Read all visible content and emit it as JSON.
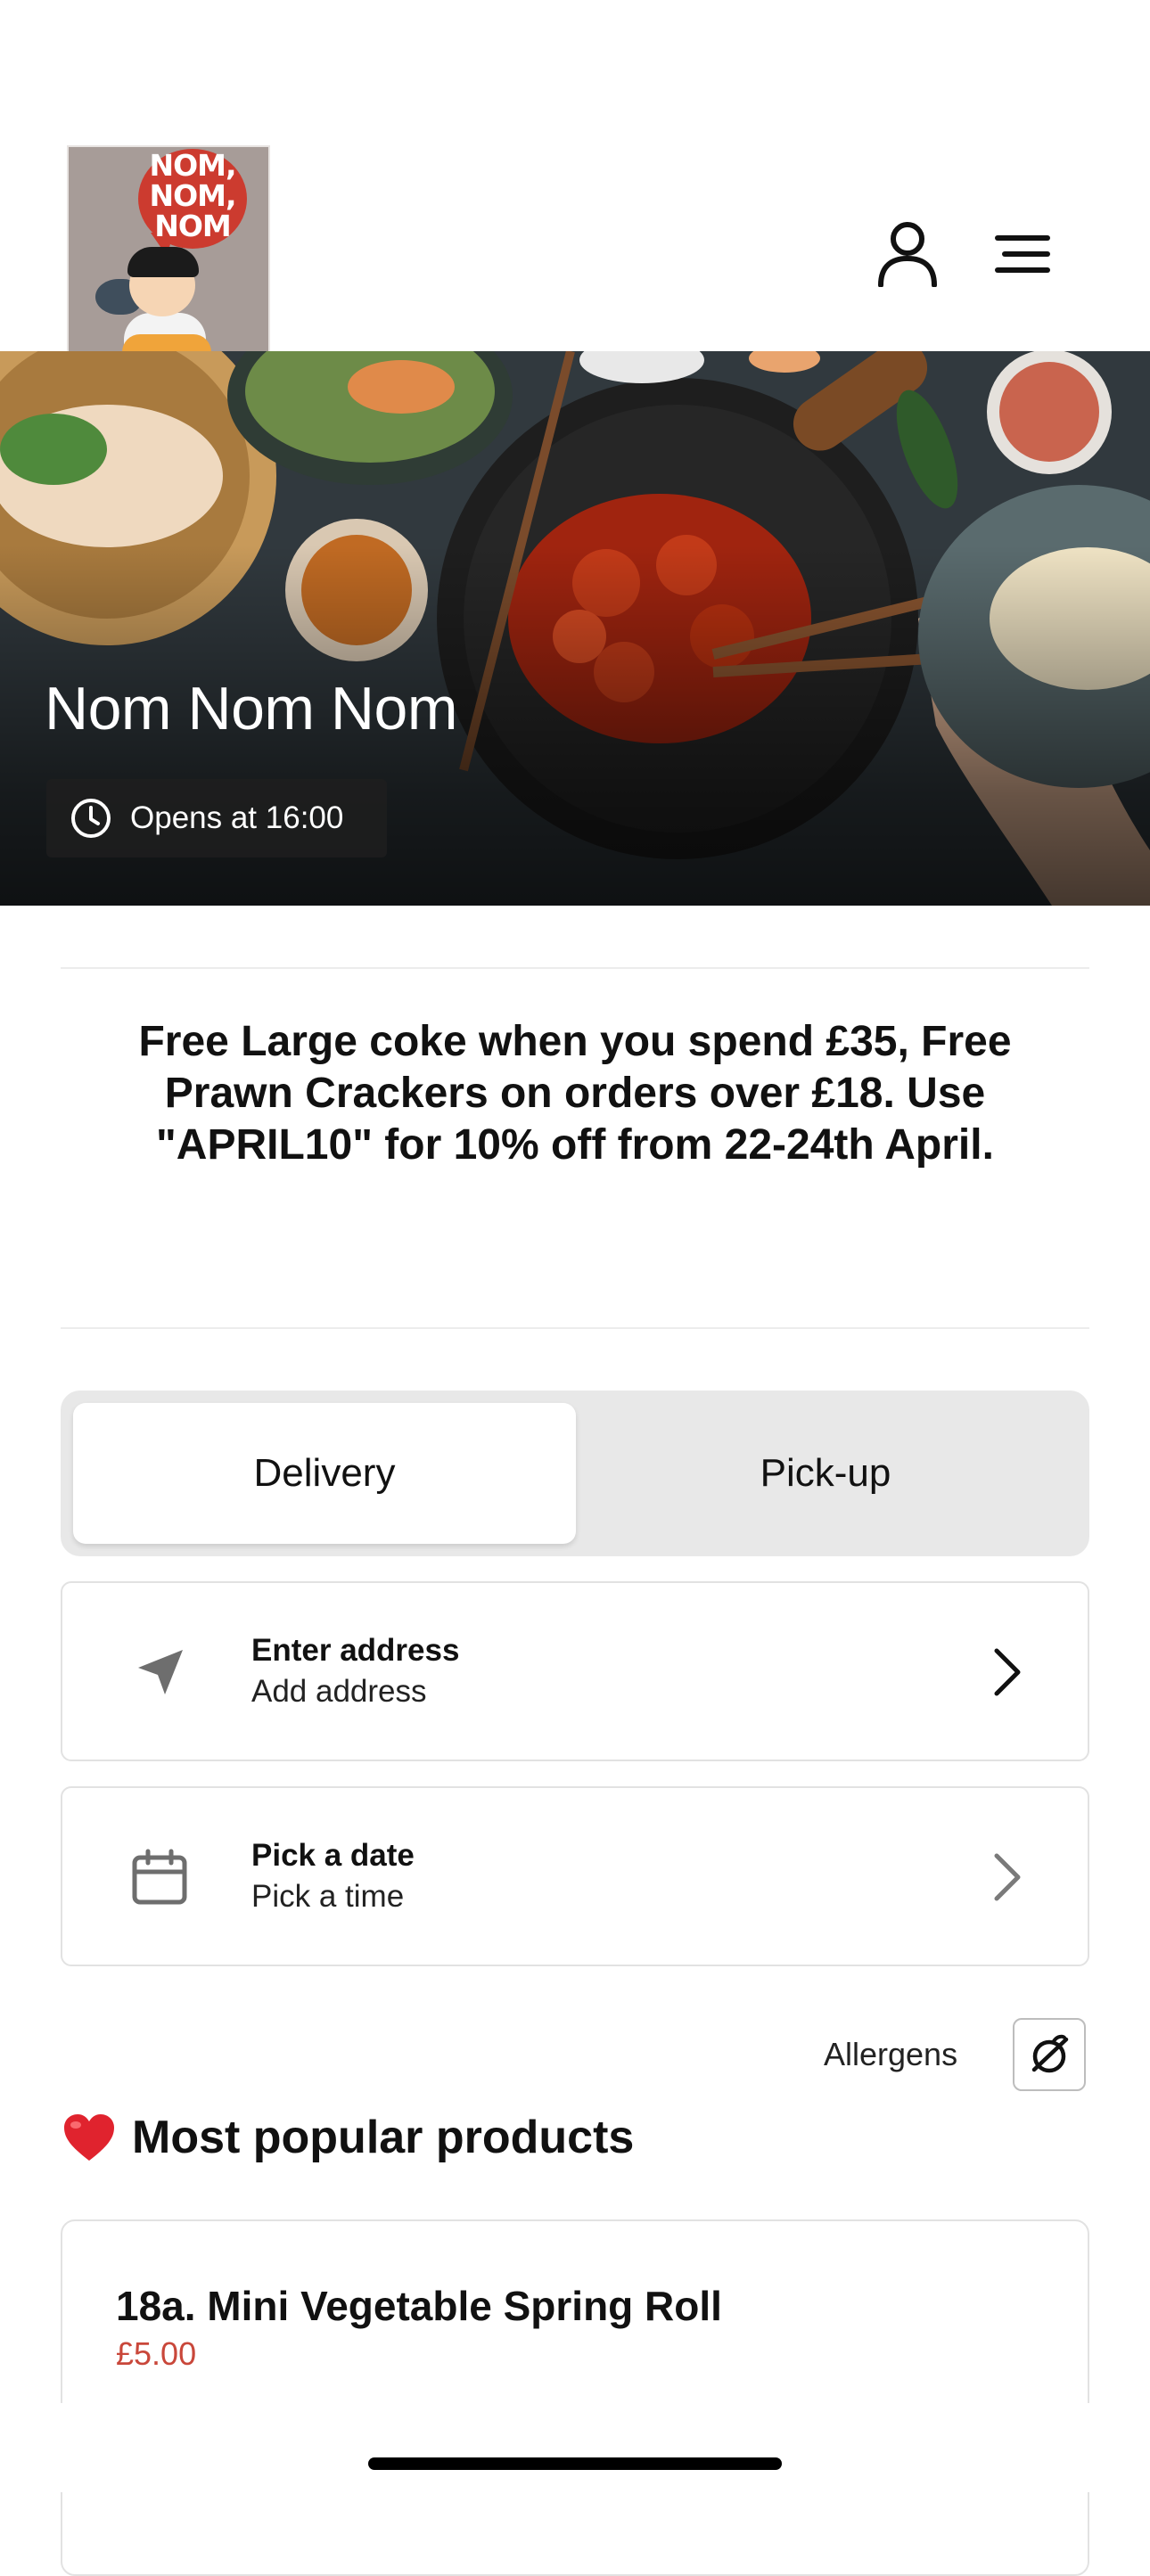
{
  "logo": {
    "text": "NOM,\nNOM,\nNOM"
  },
  "header": {
    "user_icon": "user-icon",
    "menu_icon": "menu-icon"
  },
  "hero": {
    "restaurant_name": "Nom Nom Nom",
    "opens_text": "Opens at 16:00",
    "clock_icon": "clock-icon"
  },
  "promo": {
    "text": "Free Large coke when you spend £35, Free Prawn Crackers on orders over £18. Use \"APRIL10\" for 10% off from 22-24th April."
  },
  "order_mode": {
    "options": [
      "Delivery",
      "Pick-up"
    ],
    "selected": "Delivery"
  },
  "address_card": {
    "title": "Enter address",
    "subtitle": "Add address",
    "icon": "location-arrow-icon"
  },
  "date_card": {
    "title": "Pick a date",
    "subtitle": "Pick a time",
    "icon": "calendar-icon"
  },
  "allergens": {
    "label": "Allergens",
    "icon": "allergens-icon"
  },
  "popular": {
    "title": "Most popular products",
    "icon": "heart-icon",
    "products": [
      {
        "name": "18a. Mini Vegetable Spring Roll",
        "price": "£5.00"
      }
    ]
  },
  "colors": {
    "price": "#c9473a",
    "toggle_bg": "#e8e8e8",
    "heart": "#e0232e"
  }
}
